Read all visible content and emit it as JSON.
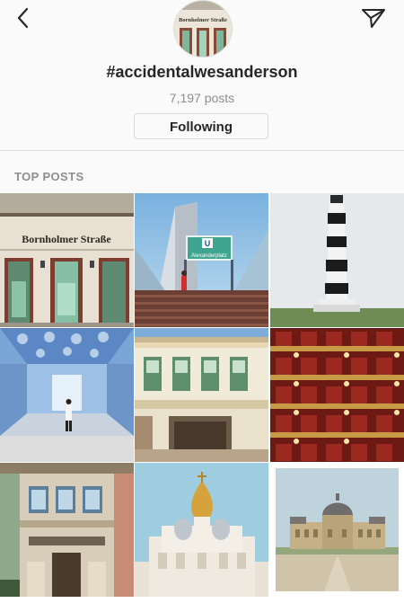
{
  "header": {
    "hashtag": "#accidentalwesanderson",
    "post_count": "7,197 posts",
    "follow_button": "Following",
    "avatar_sign": "Bornholmer Straße"
  },
  "section_title": "TOP POSTS",
  "icons": {
    "back": "chevron-left-icon",
    "share": "paper-plane-icon"
  },
  "posts": [
    {
      "name": "post-bornholmer-strasse",
      "sign_text": "Bornholmer Straße"
    },
    {
      "name": "post-alexanderplatz",
      "sign_letter": "U",
      "sign_text": "Alexanderplatz"
    },
    {
      "name": "post-lighthouse"
    },
    {
      "name": "post-blue-hall"
    },
    {
      "name": "post-shophouse"
    },
    {
      "name": "post-theater-boxes"
    },
    {
      "name": "post-colonial-building"
    },
    {
      "name": "post-cathedral"
    },
    {
      "name": "post-chateau"
    }
  ]
}
